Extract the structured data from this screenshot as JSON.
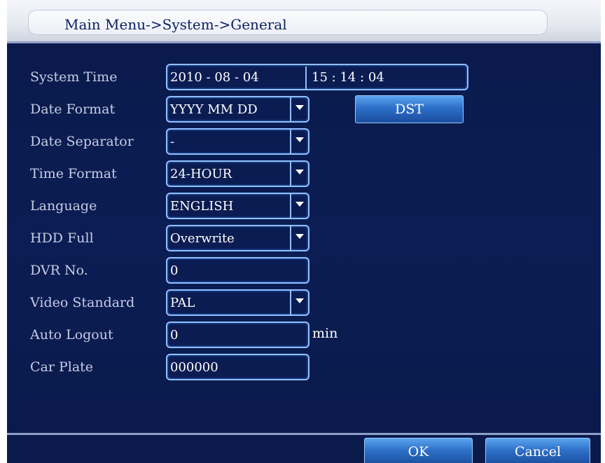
{
  "header": {
    "breadcrumb": "Main Menu->System->General"
  },
  "form": {
    "system_time": {
      "label": "System Time",
      "date": "2010   - 08 - 04",
      "time": "15  :  14  :  04"
    },
    "date_format": {
      "label": "Date Format",
      "value": "YYYY MM DD"
    },
    "dst_button": "DST",
    "date_separator": {
      "label": "Date Separator",
      "value": "-"
    },
    "time_format": {
      "label": "Time Format",
      "value": "24-HOUR"
    },
    "language": {
      "label": "Language",
      "value": "ENGLISH"
    },
    "hdd_full": {
      "label": "HDD Full",
      "value": "Overwrite"
    },
    "dvr_no": {
      "label": "DVR No.",
      "value": "0"
    },
    "video_standard": {
      "label": "Video Standard",
      "value": "PAL"
    },
    "auto_logout": {
      "label": "Auto Logout",
      "value": "0",
      "unit": "min"
    },
    "car_plate": {
      "label": "Car Plate",
      "value": "000000"
    }
  },
  "footer": {
    "ok_label": "OK",
    "cancel_label": "Cancel"
  },
  "icons": {
    "dropdown": "chevron-down-icon"
  },
  "colors": {
    "background": "#0a1a4a",
    "field_border": "#8fc0ff",
    "button": "#2d6fc8"
  }
}
